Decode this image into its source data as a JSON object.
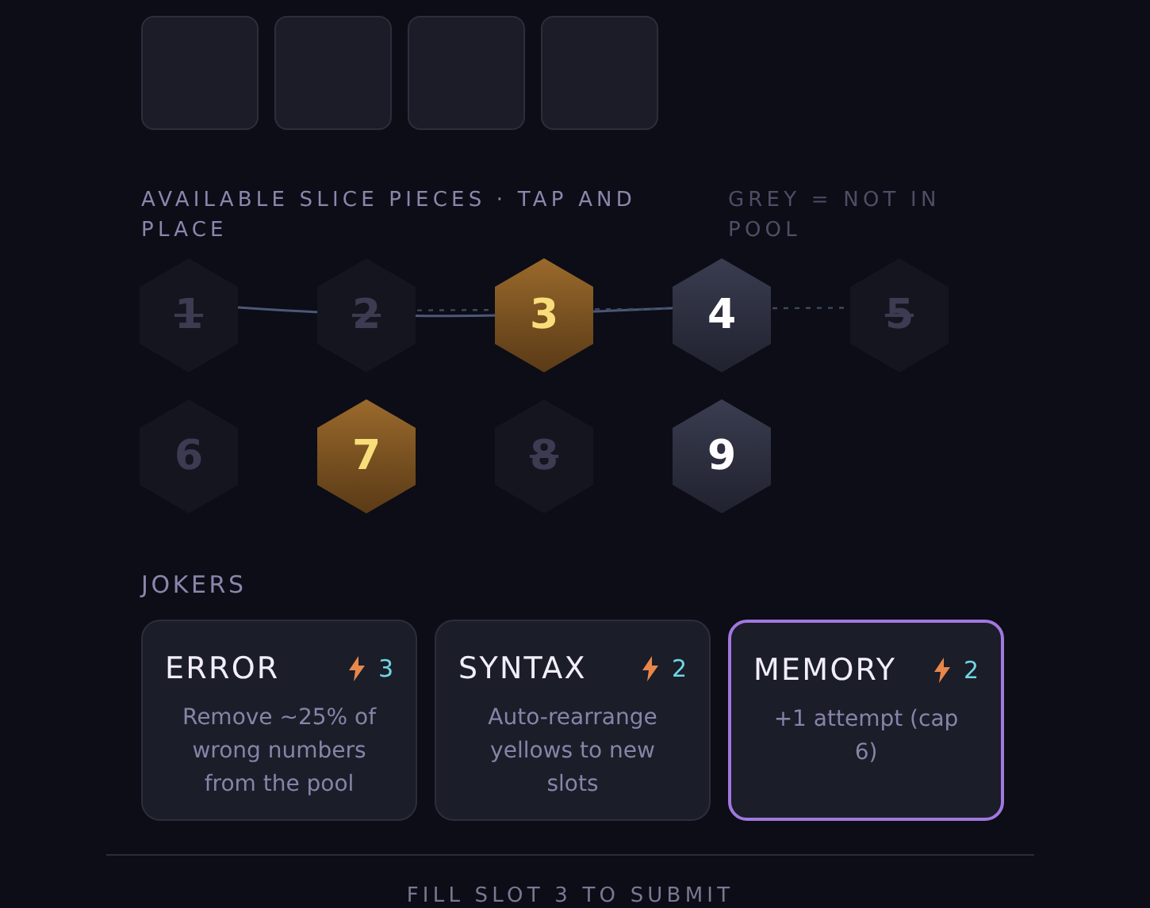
{
  "slots": [
    {
      "kind": "empty"
    },
    {
      "kind": "empty"
    },
    {
      "kind": "empty"
    },
    {
      "kind": "empty"
    }
  ],
  "pieces_header": {
    "title": "AVAILABLE SLICE PIECES · TAP AND PLACE",
    "hint": "GREY = NOT IN POOL"
  },
  "pieces": [
    {
      "label": "1",
      "kind": "struck"
    },
    {
      "label": "2",
      "kind": "struck"
    },
    {
      "label": "3",
      "kind": "gold"
    },
    {
      "label": "4",
      "kind": "plain"
    },
    {
      "label": "5",
      "kind": "struck"
    },
    {
      "label": "6",
      "kind": "grey"
    },
    {
      "label": "7",
      "kind": "gold"
    },
    {
      "label": "8",
      "kind": "struck"
    },
    {
      "label": "9",
      "kind": "plain"
    }
  ],
  "jokers_title": "JOKERS",
  "jokers": [
    {
      "name": "ERROR",
      "cost": "3",
      "description": "Remove ~25% of wrong numbers from the pool",
      "selected": false
    },
    {
      "name": "SYNTAX",
      "cost": "2",
      "description": "Auto-rearrange yellows to new slots",
      "selected": false
    },
    {
      "name": "MEMORY",
      "cost": "2",
      "description": "+1 attempt (cap 6)",
      "selected": true
    }
  ],
  "footer": "FILL SLOT 3 TO SUBMIT"
}
